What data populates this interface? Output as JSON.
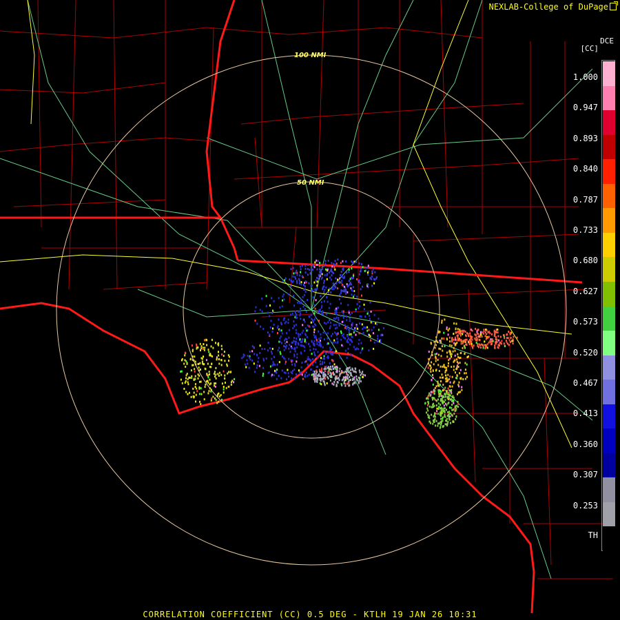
{
  "credit": "NEXLAB-College of DuPage",
  "icon": "external-link-icon",
  "station": "DCE",
  "product_abbrev": "[CC]",
  "range_rings": [
    "100 NMI",
    "50 NMI"
  ],
  "colorbar": {
    "ticks": [
      "1.000",
      "0.947",
      "0.893",
      "0.840",
      "0.787",
      "0.733",
      "0.680",
      "0.627",
      "0.573",
      "0.520",
      "0.467",
      "0.413",
      "0.360",
      "0.307",
      "0.253",
      "TH"
    ],
    "colors": [
      "#ffb0d0",
      "#ff80b0",
      "#e00030",
      "#c00000",
      "#ff2000",
      "#ff6000",
      "#ff9a00",
      "#ffd000",
      "#cccc00",
      "#80c000",
      "#40d040",
      "#80ff80",
      "#9090e0",
      "#7070e0",
      "#1010e0",
      "#0000c0",
      "#0000a0",
      "#9090a0",
      "#a0a0a8",
      "#000000"
    ]
  },
  "footer": "CORRELATION COEFFICIENT (CC) 0.5 DEG - KTLH 19 JAN 26 10:31"
}
